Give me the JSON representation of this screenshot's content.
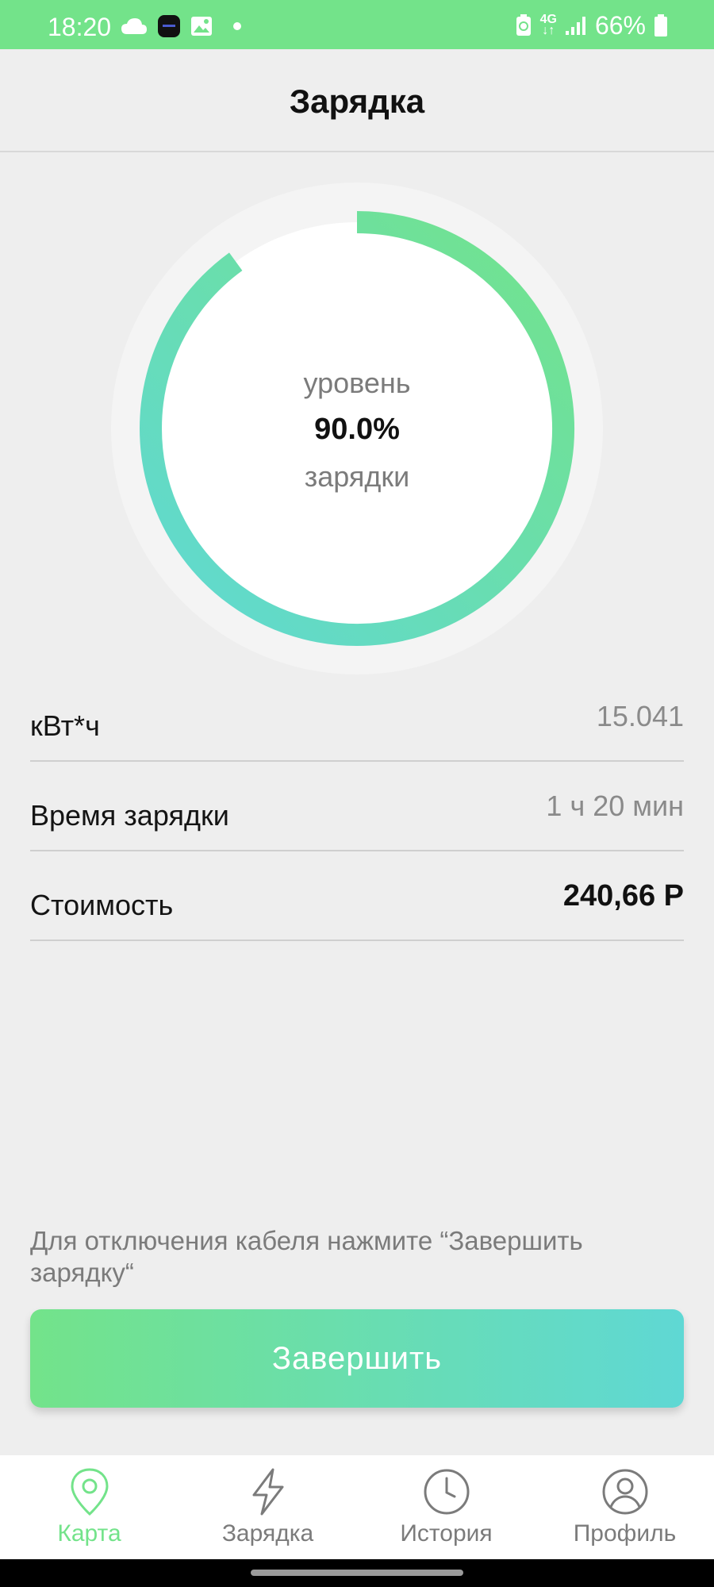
{
  "status_bar": {
    "time": "18:20",
    "battery_percent": "66%",
    "network": "4G",
    "icons": [
      "cloud-icon",
      "app-icon",
      "image-icon",
      "dot-icon",
      "battery-saver-icon",
      "network-4g-icon",
      "signal-icon",
      "battery-icon"
    ]
  },
  "header": {
    "title": "Зарядка"
  },
  "gauge": {
    "label_top": "уровень",
    "value": "90.0%",
    "fraction": 0.9,
    "label_bottom": "зарядки",
    "colors": {
      "start": "#73e38a",
      "end": "#5fd8d4",
      "track": "#f4f4f4",
      "inner": "#ffffff"
    }
  },
  "rows": [
    {
      "label": "кВт*ч",
      "value": "15.041"
    },
    {
      "label": "Время зарядки",
      "value": "1 ч 20 мин"
    },
    {
      "label": "Стоимость",
      "value": "240,66 Р"
    }
  ],
  "hint": "Для отключения кабеля нажмите “Завершить зарядку“",
  "finish_button": {
    "label": "Завершить"
  },
  "nav": [
    {
      "label": "Карта",
      "icon": "map-pin-icon",
      "active": true
    },
    {
      "label": "Зарядка",
      "icon": "lightning-icon",
      "active": false
    },
    {
      "label": "История",
      "icon": "clock-icon",
      "active": false
    },
    {
      "label": "Профиль",
      "icon": "user-icon",
      "active": false
    }
  ],
  "colors": {
    "accent": "#73e38a",
    "accent2": "#5fd8d4",
    "background": "#eeeeee",
    "inactive": "#7b7b7b"
  }
}
